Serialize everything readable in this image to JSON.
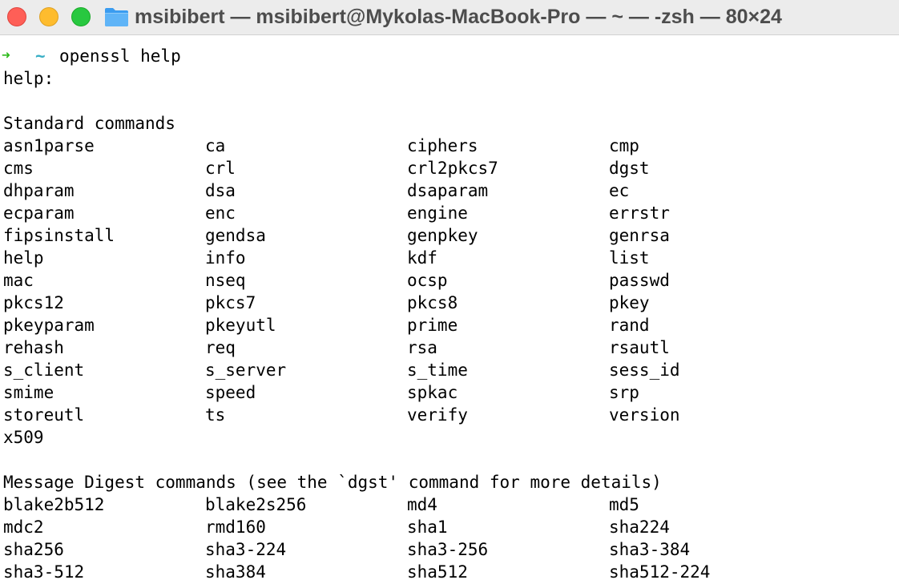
{
  "window": {
    "title": "msibibert — msibibert@Mykolas-MacBook-Pro — ~ — -zsh — 80×24",
    "icon": "folder-icon",
    "colors": {
      "close": "#fe5f57",
      "minimize": "#febc2e",
      "maximize": "#28c840",
      "prompt_arrow": "#2dba1b",
      "prompt_tilde": "#38aec5"
    }
  },
  "prompt": {
    "arrow": "➜",
    "cwd": "~",
    "command": "openssl help"
  },
  "output": {
    "help_label": "help:",
    "standard_header": "Standard commands",
    "standard_rows": [
      [
        "asn1parse",
        "ca",
        "ciphers",
        "cmp"
      ],
      [
        "cms",
        "crl",
        "crl2pkcs7",
        "dgst"
      ],
      [
        "dhparam",
        "dsa",
        "dsaparam",
        "ec"
      ],
      [
        "ecparam",
        "enc",
        "engine",
        "errstr"
      ],
      [
        "fipsinstall",
        "gendsa",
        "genpkey",
        "genrsa"
      ],
      [
        "help",
        "info",
        "kdf",
        "list"
      ],
      [
        "mac",
        "nseq",
        "ocsp",
        "passwd"
      ],
      [
        "pkcs12",
        "pkcs7",
        "pkcs8",
        "pkey"
      ],
      [
        "pkeyparam",
        "pkeyutl",
        "prime",
        "rand"
      ],
      [
        "rehash",
        "req",
        "rsa",
        "rsautl"
      ],
      [
        "s_client",
        "s_server",
        "s_time",
        "sess_id"
      ],
      [
        "smime",
        "speed",
        "spkac",
        "srp"
      ],
      [
        "storeutl",
        "ts",
        "verify",
        "version"
      ],
      [
        "x509",
        "",
        "",
        ""
      ]
    ],
    "digest_header": "Message Digest commands (see the `dgst' command for more details)",
    "digest_rows": [
      [
        "blake2b512",
        "blake2s256",
        "md4",
        "md5"
      ],
      [
        "mdc2",
        "rmd160",
        "sha1",
        "sha224"
      ],
      [
        "sha256",
        "sha3-224",
        "sha3-256",
        "sha3-384"
      ],
      [
        "sha3-512",
        "sha384",
        "sha512",
        "sha512-224"
      ]
    ]
  }
}
